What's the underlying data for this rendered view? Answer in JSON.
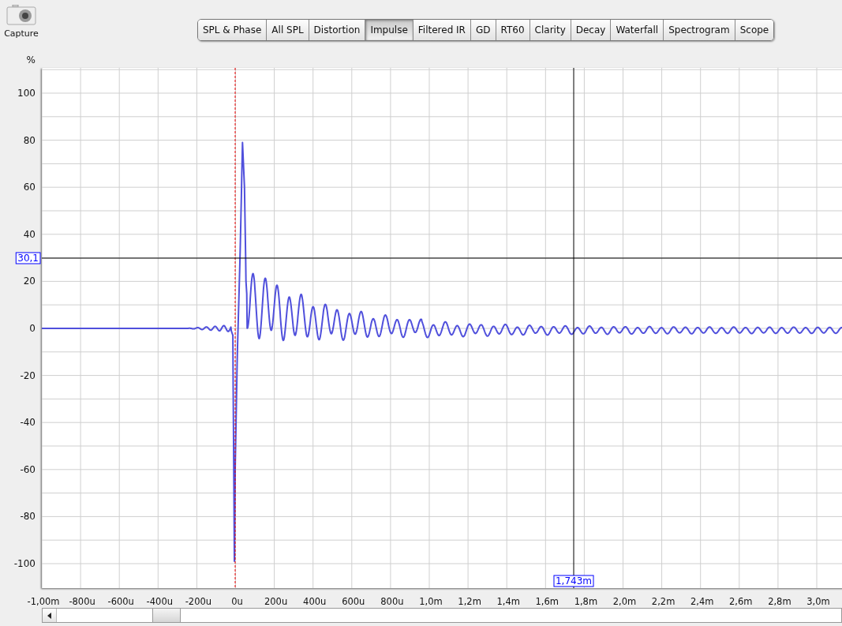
{
  "capture": {
    "label": "Capture"
  },
  "tabs": [
    {
      "label": "SPL & Phase",
      "selected": false
    },
    {
      "label": "All SPL",
      "selected": false
    },
    {
      "label": "Distortion",
      "selected": false
    },
    {
      "label": "Impulse",
      "selected": true
    },
    {
      "label": "Filtered IR",
      "selected": false
    },
    {
      "label": "GD",
      "selected": false
    },
    {
      "label": "RT60",
      "selected": false
    },
    {
      "label": "Clarity",
      "selected": false
    },
    {
      "label": "Decay",
      "selected": false
    },
    {
      "label": "Waterfall",
      "selected": false
    },
    {
      "label": "Spectrogram",
      "selected": false
    },
    {
      "label": "Scope",
      "selected": false
    }
  ],
  "plot": {
    "y_unit": "%",
    "y_ticks": [
      "100",
      "80",
      "60",
      "40",
      "20",
      "0",
      "-20",
      "-40",
      "-60",
      "-80",
      "-100"
    ],
    "x_ticks": [
      "-1,00m",
      "-800u",
      "-600u",
      "-400u",
      "-200u",
      "0u",
      "200u",
      "400u",
      "600u",
      "800u",
      "1,0m",
      "1,2m",
      "1,4m",
      "1,6m",
      "1,8m",
      "2,0m",
      "2,2m",
      "2,4m",
      "2,6m",
      "2,8m",
      "3,0m"
    ],
    "cursor": {
      "y_readout": "30,1",
      "x_readout": "1,743m"
    }
  }
}
